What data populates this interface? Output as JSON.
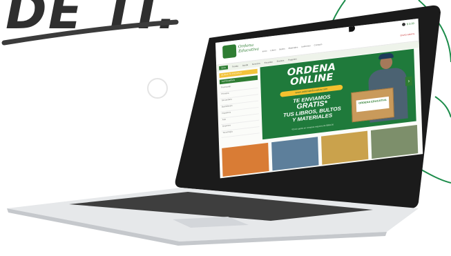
{
  "headline": "DE TI.",
  "site": {
    "logo_line1": "Ordena",
    "logo_line2": "Educativa",
    "nav": [
      "Inicio",
      "Libros",
      "Bultos",
      "Materiales",
      "Uniformes",
      "Contacto"
    ],
    "cart": "$ 0.00",
    "promo": "ENVÍO GRATIS",
    "menu": [
      "Inicio",
      "Tienda",
      "Ayuda",
      "Nosotros",
      "Escuelas",
      "Eventos",
      "Paquetes"
    ],
    "sidebar_buttons": [
      "BUSCA TU ESCUELA",
      "CATEGORÍAS"
    ],
    "sidebar_items": [
      "Preescolar",
      "Primaria",
      "Secundaria",
      "Bachillerato",
      "Papelería",
      "Arte",
      "Deportes",
      "Tecnología"
    ],
    "hero": {
      "title_line1": "ORDENA",
      "title_line2": "ONLINE",
      "pill": "www.ordenaeducativa.com",
      "line1": "TE ENVIAMOS",
      "line2": "GRATIS*",
      "line3": "TUS LIBROS, BULTOS",
      "line4": "Y MATERIALES",
      "note": "*Envío gratis en compras mayores de $999.00",
      "box_label": "ORDENA EDUCATIVA"
    }
  },
  "colors": {
    "brand_green": "#2e7d32",
    "accent_yellow": "#f2c33a",
    "hero_green": "#1f7a3b"
  }
}
